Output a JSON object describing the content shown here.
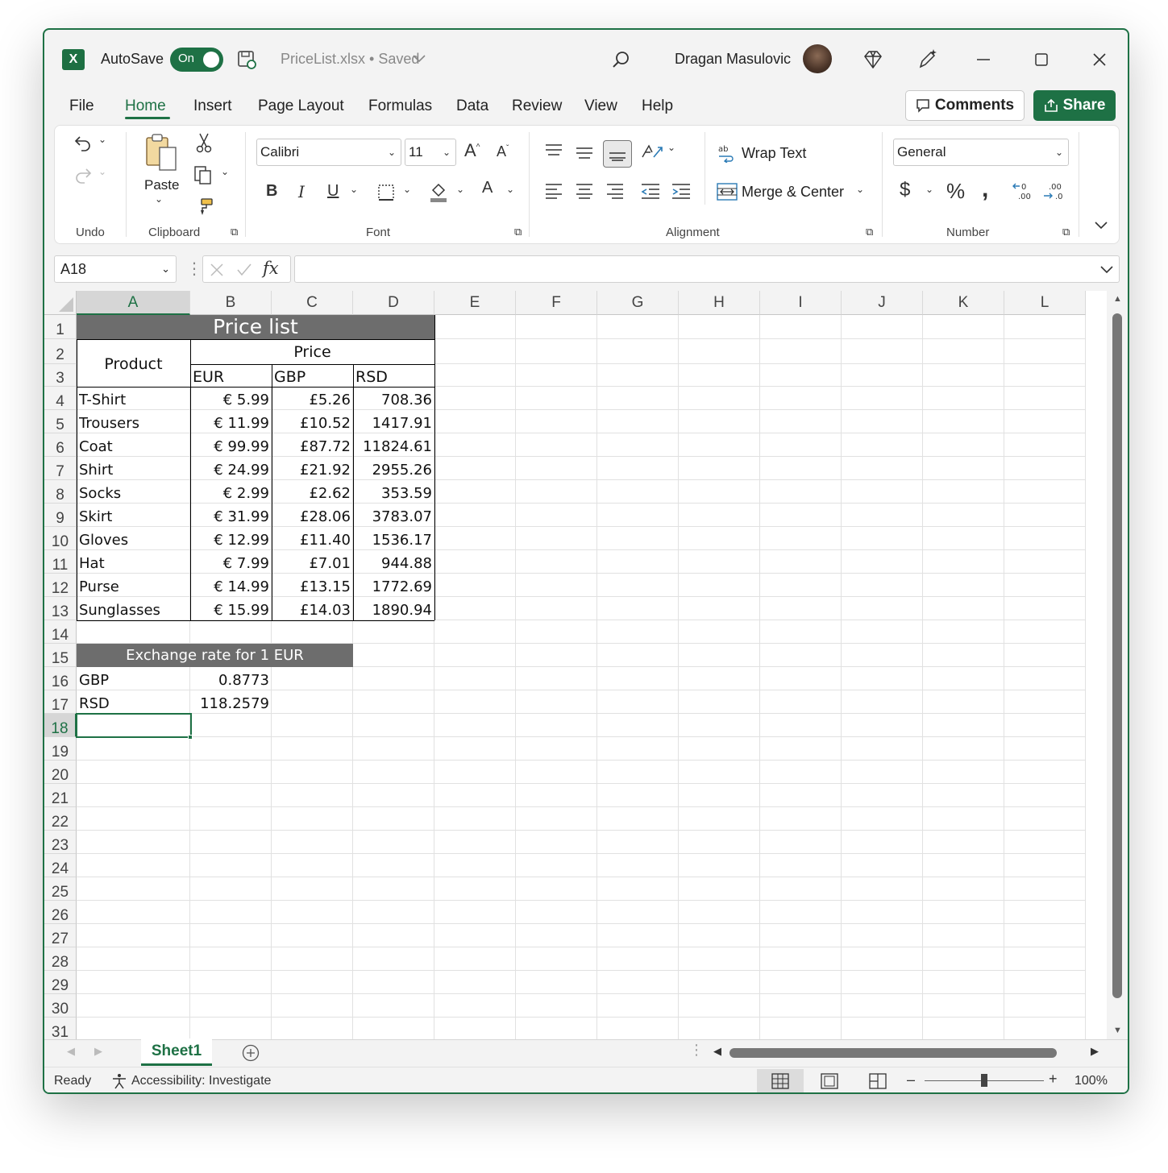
{
  "titlebar": {
    "autosave_label": "AutoSave",
    "autosave_state": "On",
    "filename": "PriceList.xlsx • Saved",
    "user_name": "Dragan Masulovic"
  },
  "menu": {
    "items": [
      "File",
      "Home",
      "Insert",
      "Page Layout",
      "Formulas",
      "Data",
      "Review",
      "View",
      "Help"
    ],
    "active": "Home",
    "comments_label": "Comments",
    "share_label": "Share"
  },
  "ribbon": {
    "groups": {
      "undo": "Undo",
      "clipboard": "Clipboard",
      "font": "Font",
      "alignment": "Alignment",
      "number": "Number"
    },
    "paste_label": "Paste",
    "font_name": "Calibri",
    "font_size": "11",
    "wrap_text_label": "Wrap Text",
    "merge_center_label": "Merge & Center",
    "number_format": "General"
  },
  "formula_bar": {
    "name_box": "A18",
    "formula": ""
  },
  "grid": {
    "columns": [
      "A",
      "B",
      "C",
      "D",
      "E",
      "F",
      "G",
      "H",
      "I",
      "J",
      "K",
      "L"
    ],
    "selected_column": "A",
    "selected_row": "18",
    "rows": [
      "1",
      "2",
      "3",
      "4",
      "5",
      "6",
      "7",
      "8",
      "9",
      "10",
      "11",
      "12",
      "13",
      "14",
      "15",
      "16",
      "17",
      "18",
      "19",
      "20",
      "21",
      "22",
      "23",
      "24",
      "25",
      "26",
      "27",
      "28",
      "29",
      "30",
      "31"
    ],
    "table": {
      "title": "Price list",
      "product_header": "Product",
      "price_header": "Price",
      "currencies": [
        "EUR",
        "GBP",
        "RSD"
      ],
      "rows": [
        {
          "product": "T-Shirt",
          "eur": "€ 5.99",
          "gbp": "£5.26",
          "rsd": "708.36"
        },
        {
          "product": "Trousers",
          "eur": "€ 11.99",
          "gbp": "£10.52",
          "rsd": "1417.91"
        },
        {
          "product": "Coat",
          "eur": "€ 99.99",
          "gbp": "£87.72",
          "rsd": "11824.61"
        },
        {
          "product": "Shirt",
          "eur": "€ 24.99",
          "gbp": "£21.92",
          "rsd": "2955.26"
        },
        {
          "product": "Socks",
          "eur": "€ 2.99",
          "gbp": "£2.62",
          "rsd": "353.59"
        },
        {
          "product": "Skirt",
          "eur": "€ 31.99",
          "gbp": "£28.06",
          "rsd": "3783.07"
        },
        {
          "product": "Gloves",
          "eur": "€ 12.99",
          "gbp": "£11.40",
          "rsd": "1536.17"
        },
        {
          "product": "Hat",
          "eur": "€ 7.99",
          "gbp": "£7.01",
          "rsd": "944.88"
        },
        {
          "product": "Purse",
          "eur": "€ 14.99",
          "gbp": "£13.15",
          "rsd": "1772.69"
        },
        {
          "product": "Sunglasses",
          "eur": "€ 15.99",
          "gbp": "£14.03",
          "rsd": "1890.94"
        }
      ]
    },
    "exchange": {
      "title": "Exchange rate for 1 EUR",
      "rows": [
        {
          "currency": "GBP",
          "rate": "0.8773"
        },
        {
          "currency": "RSD",
          "rate": "118.2579"
        }
      ]
    }
  },
  "sheets": {
    "tabs": [
      "Sheet1"
    ],
    "active": "Sheet1"
  },
  "status_bar": {
    "ready": "Ready",
    "accessibility": "Accessibility: Investigate",
    "zoom": "100%",
    "zoom_fraction": 0.5
  },
  "colors": {
    "accent": "#1e7145",
    "header_fill": "#6d6d6d"
  }
}
